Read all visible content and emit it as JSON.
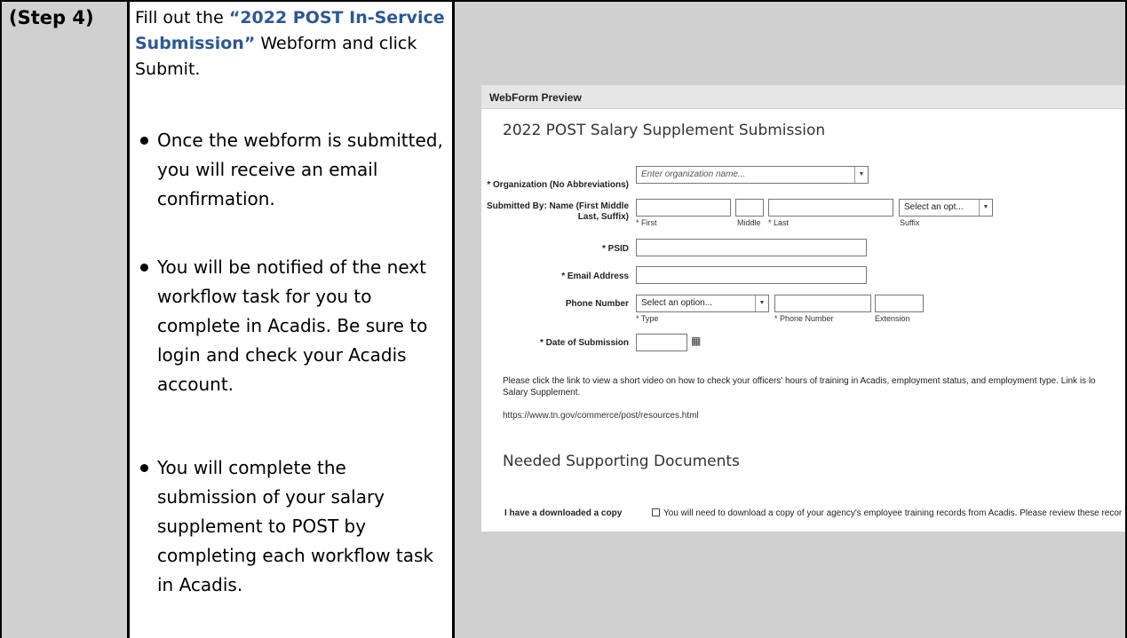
{
  "step": {
    "label": "(Step 4)"
  },
  "instructions": {
    "intro_prefix": "Fill out the ",
    "intro_highlight": "“2022 POST In-Service Submission”",
    "intro_suffix": " Webform and click Submit.",
    "bullets": [
      "Once the webform is submitted, you will receive an email confirmation.",
      "You will be notified of the next workflow task for you to complete in Acadis. Be sure to login and check your Acadis account.",
      "You will complete the submission of your salary supplement to POST by completing each workflow task in Acadis."
    ]
  },
  "webform": {
    "header": "WebForm Preview",
    "title": "2022 POST Salary Supplement Submission",
    "organization": {
      "label": "* Organization (No Abbreviations)",
      "placeholder": "Enter organization name..."
    },
    "submitted_by": {
      "label": "Submitted By: Name (First Middle Last, Suffix)",
      "first_sub": "* First",
      "middle_sub": "Middle",
      "last_sub": "* Last",
      "suffix_value": "Select an opt...",
      "suffix_sub": "Suffix"
    },
    "psid": {
      "label": "* PSID"
    },
    "email": {
      "label": "* Email Address"
    },
    "phone": {
      "label": "Phone Number",
      "type_value": "Select an option...",
      "type_sub": "* Type",
      "number_sub": "* Phone Number",
      "extension_sub": "Extension"
    },
    "date": {
      "label": "* Date of Submission",
      "icon": "calendar-icon"
    },
    "video_text": "Please click the link to view a short video on how to check your officers' hours of training in Acadis, employment status, and employment type. Link is lo",
    "video_text_2": "Salary Supplement.",
    "link": "https://www.tn.gov/commerce/post/resources.html",
    "section_title": "Needed Supporting Documents",
    "doc_label": "I have a downloaded a copy",
    "doc_text": "You will need to download a copy of your agency's employee training records from Acadis. Please review these recor",
    "dropdown_icon": "chevron-down-icon"
  },
  "colors": {
    "highlight": "#2d5895",
    "cell_gray": "#d0d0d0",
    "required_red": "#cc0000"
  }
}
